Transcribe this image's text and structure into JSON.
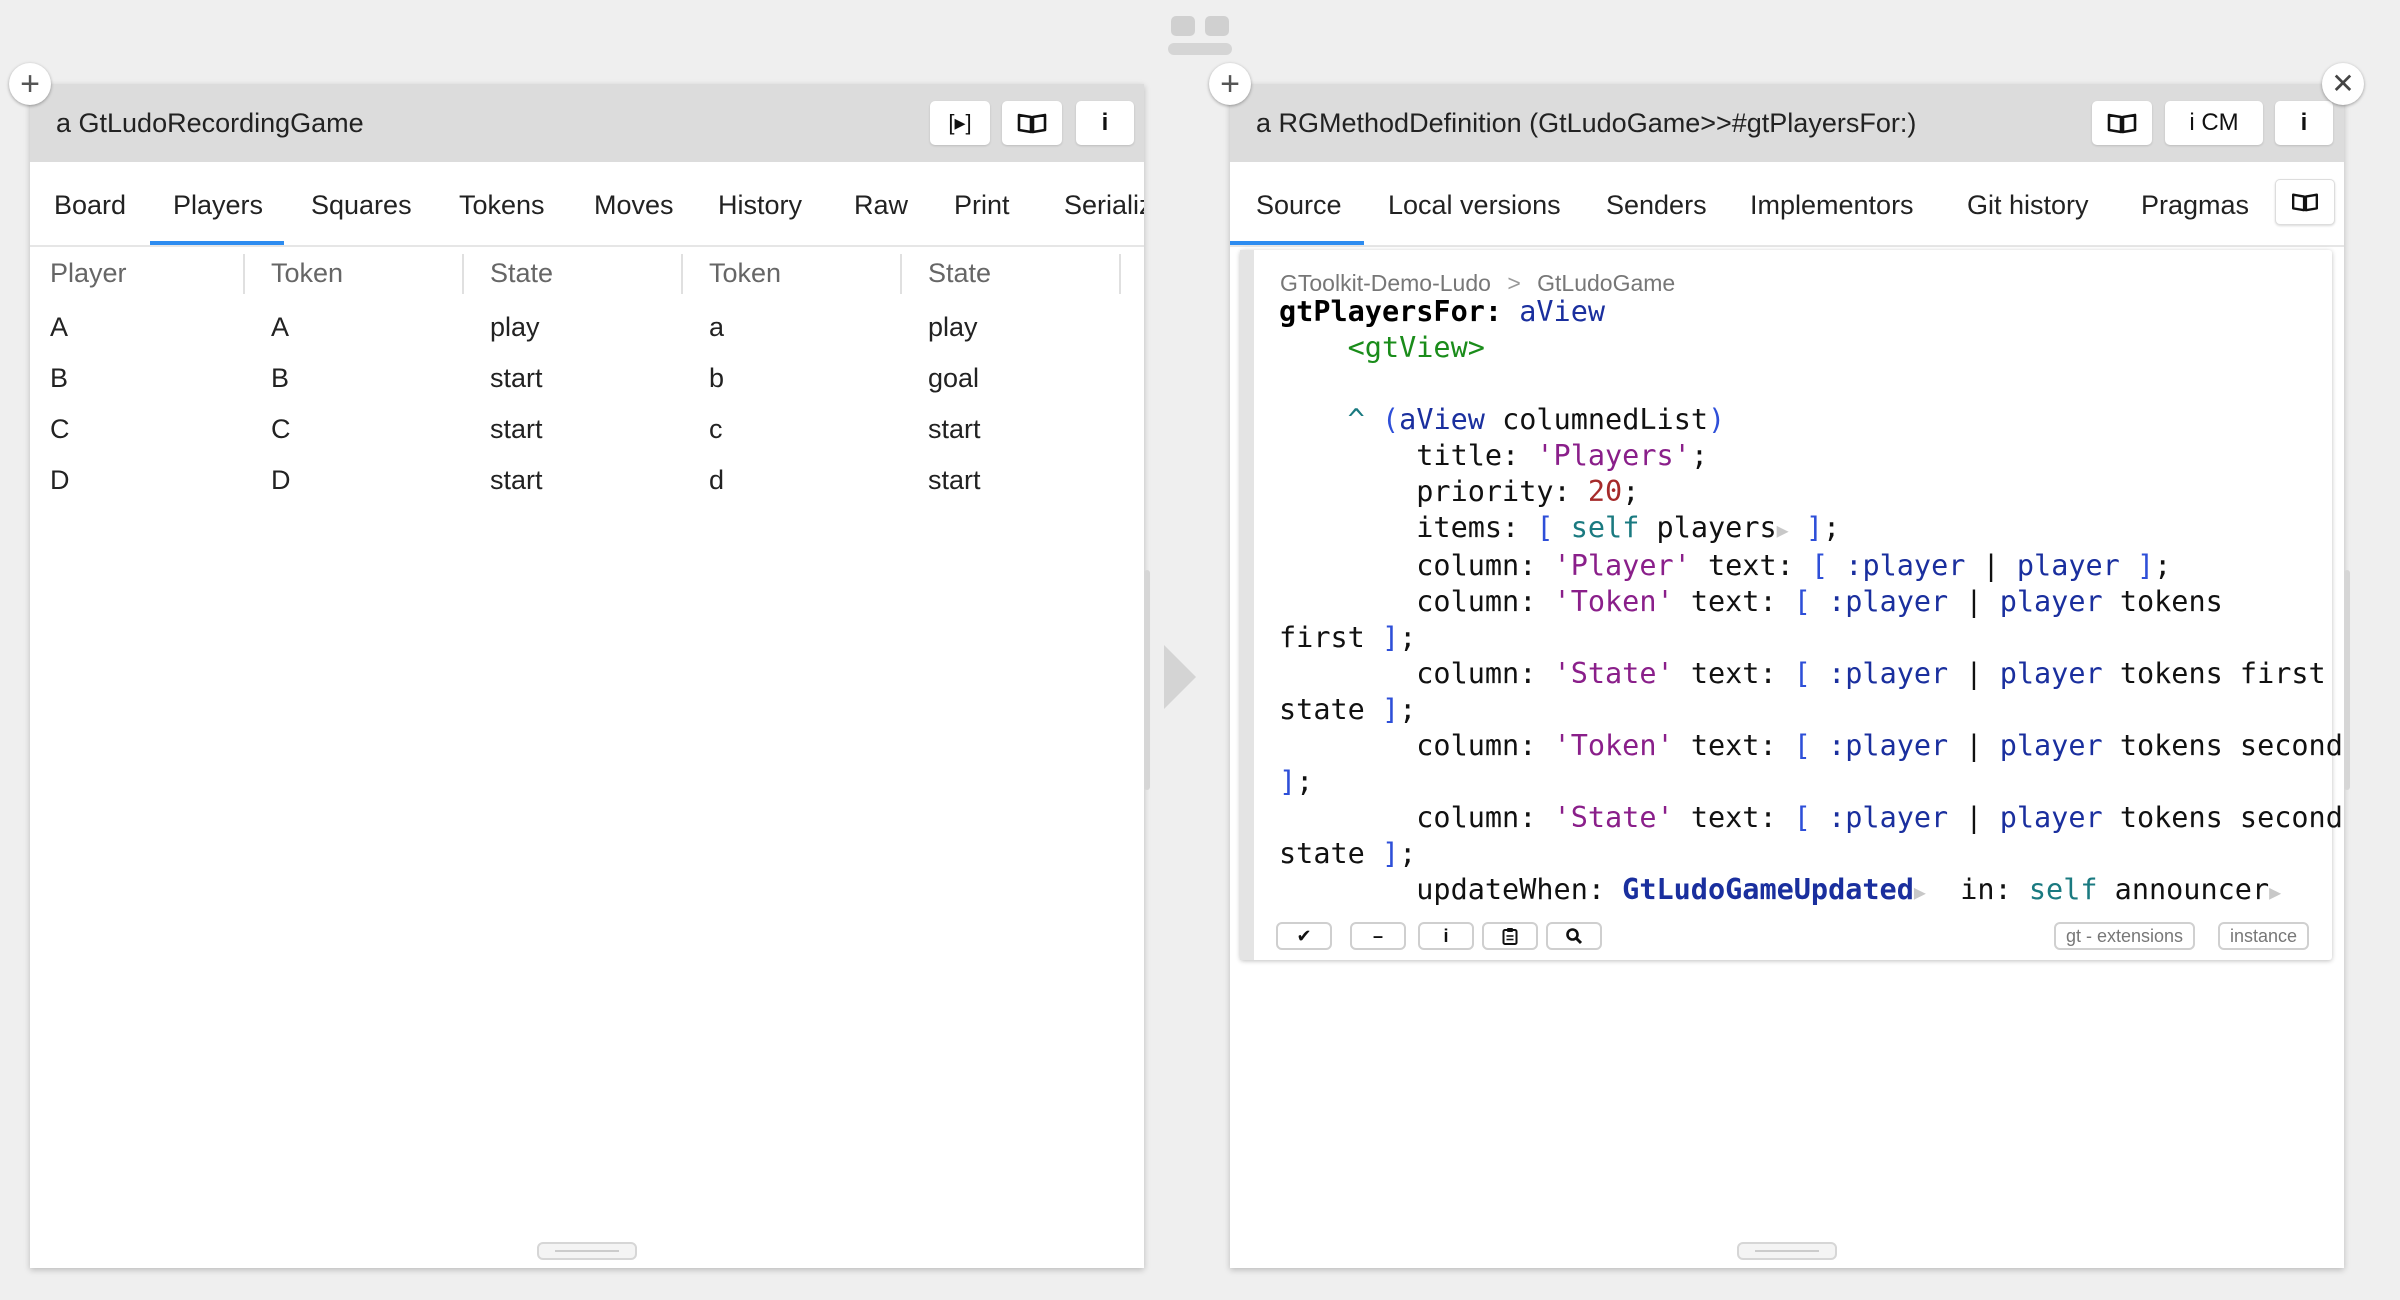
{
  "left_pane": {
    "title": "a GtLudoRecordingGame",
    "toolbar": {
      "play_label": "[▸]",
      "book_icon": "book-icon",
      "inspect_label": "i"
    },
    "tabs": [
      "Board",
      "Players",
      "Squares",
      "Tokens",
      "Moves",
      "History",
      "Raw",
      "Print",
      "Serializ"
    ],
    "active_tab": "Players",
    "table": {
      "headers": [
        "Player",
        "Token",
        "State",
        "Token",
        "State"
      ],
      "rows": [
        [
          "A",
          "A",
          "play",
          "a",
          "play"
        ],
        [
          "B",
          "B",
          "start",
          "b",
          "goal"
        ],
        [
          "C",
          "C",
          "start",
          "c",
          "start"
        ],
        [
          "D",
          "D",
          "start",
          "d",
          "start"
        ]
      ]
    }
  },
  "right_pane": {
    "title": "a RGMethodDefinition (GtLudoGame>>#gtPlayersFor:)",
    "toolbar": {
      "book_icon": "book-icon",
      "inspect_cm_label": "i CM",
      "inspect_label": "i"
    },
    "tabs": [
      "Source",
      "Local versions",
      "Senders",
      "Implementors",
      "Git history",
      "Pragmas"
    ],
    "active_tab": "Source",
    "breadcrumb": {
      "package": "GToolkit-Demo-Ludo",
      "separator": ">",
      "class": "GtLudoGame"
    },
    "editor_buttons": [
      "✔",
      "–",
      "i",
      "clipboard-icon",
      "search-icon"
    ],
    "editor_tags": [
      "gt - extensions",
      "instance"
    ]
  },
  "accent_color": "#2d8cf0"
}
